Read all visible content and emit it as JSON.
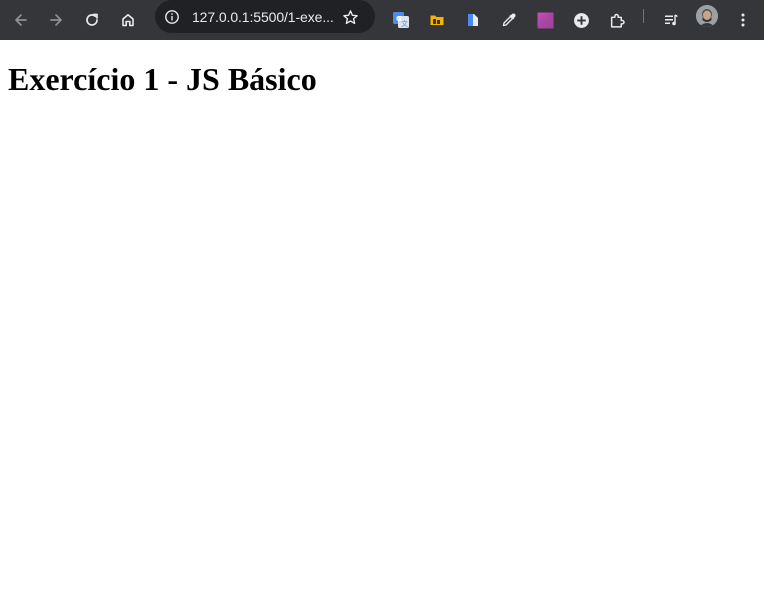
{
  "browser": {
    "address_bar": {
      "url_text": "127.0.0.1:5500/1-exe..."
    },
    "toolbar_icons": [
      "back-icon",
      "forward-icon",
      "reload-icon",
      "home-icon",
      "site-info-icon",
      "bookmark-star-icon",
      "translate-extension-icon",
      "folder-extension-icon",
      "document-extension-icon",
      "color-picker-extension-icon",
      "gradient-extension-icon",
      "add-circle-extension-icon",
      "extensions-puzzle-icon",
      "reading-list-icon",
      "profile-avatar",
      "menu-kebab-icon"
    ],
    "colors": {
      "toolbar_bg": "#35363a",
      "omnibox_bg": "#202124",
      "icon_color": "#e8eaed",
      "icon_disabled": "#8e9094"
    }
  },
  "page": {
    "heading": "Exercício 1 - JS Básico"
  }
}
